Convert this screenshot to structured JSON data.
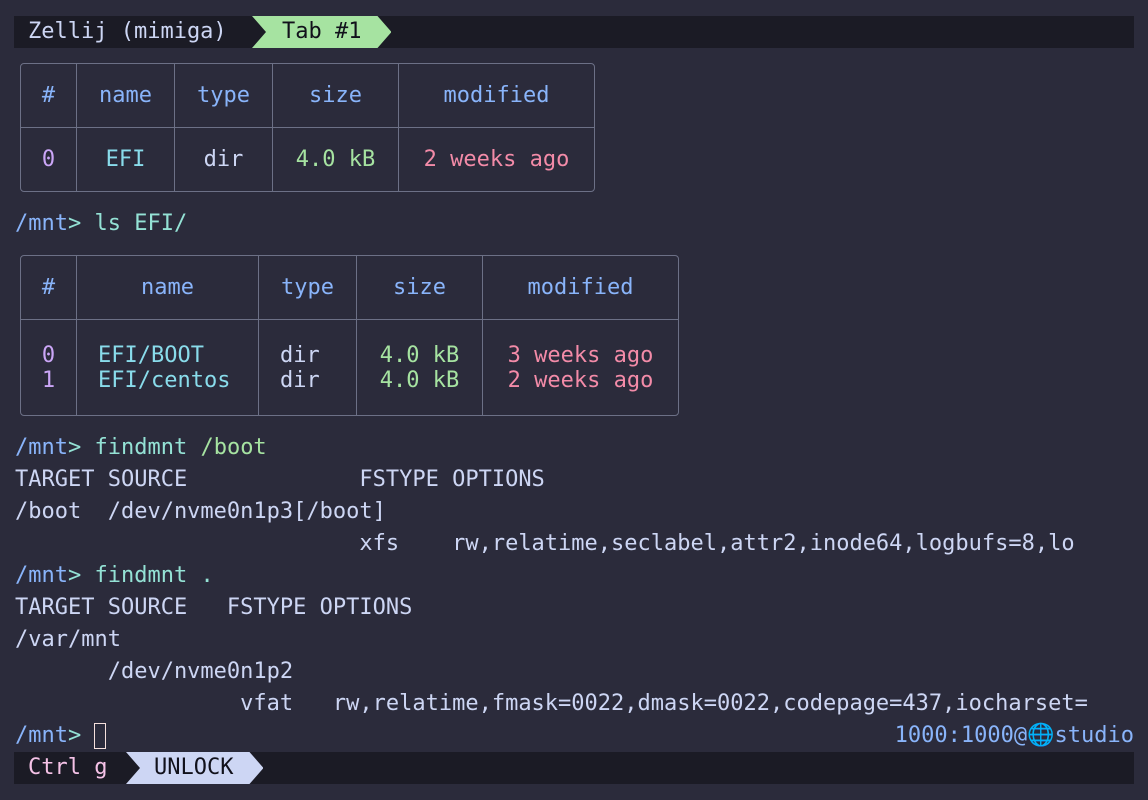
{
  "top_bar": {
    "session": "Zellij (mimiga)",
    "tab": "Tab #1"
  },
  "prompt": {
    "path": "/mnt",
    "sym": ">"
  },
  "table1": {
    "headers": [
      "#",
      "name",
      "type",
      "size",
      "modified"
    ],
    "rows": [
      [
        "0",
        "EFI",
        "dir",
        "4.0 kB",
        "2 weeks ago"
      ]
    ]
  },
  "cmd1": {
    "cmd": "ls",
    "arg": "EFI/"
  },
  "table2": {
    "headers": [
      "#",
      "name",
      "type",
      "size",
      "modified"
    ],
    "rows": [
      [
        "0",
        "EFI/BOOT",
        "dir",
        "4.0 kB",
        "3 weeks ago"
      ],
      [
        "1",
        "EFI/centos",
        "dir",
        "4.0 kB",
        "2 weeks ago"
      ]
    ]
  },
  "cmd2": {
    "cmd": "findmnt",
    "arg": "/boot"
  },
  "out2": [
    "TARGET SOURCE             FSTYPE OPTIONS",
    "/boot  /dev/nvme0n1p3[/boot]",
    "                          xfs    rw,relatime,seclabel,attr2,inode64,logbufs=8,lo"
  ],
  "cmd3": {
    "cmd": "findmnt",
    "arg": "."
  },
  "out3": [
    "TARGET SOURCE   FSTYPE OPTIONS",
    "/var/mnt",
    "       /dev/nvme0n1p2",
    "                 vfat   rw,relatime,fmask=0022,dmask=0022,codepage=437,iocharset="
  ],
  "right_prompt": {
    "user": "1000:1000@",
    "host": "studio"
  },
  "bottom_bar": {
    "key": "Ctrl g",
    "mode": "UNLOCK"
  }
}
